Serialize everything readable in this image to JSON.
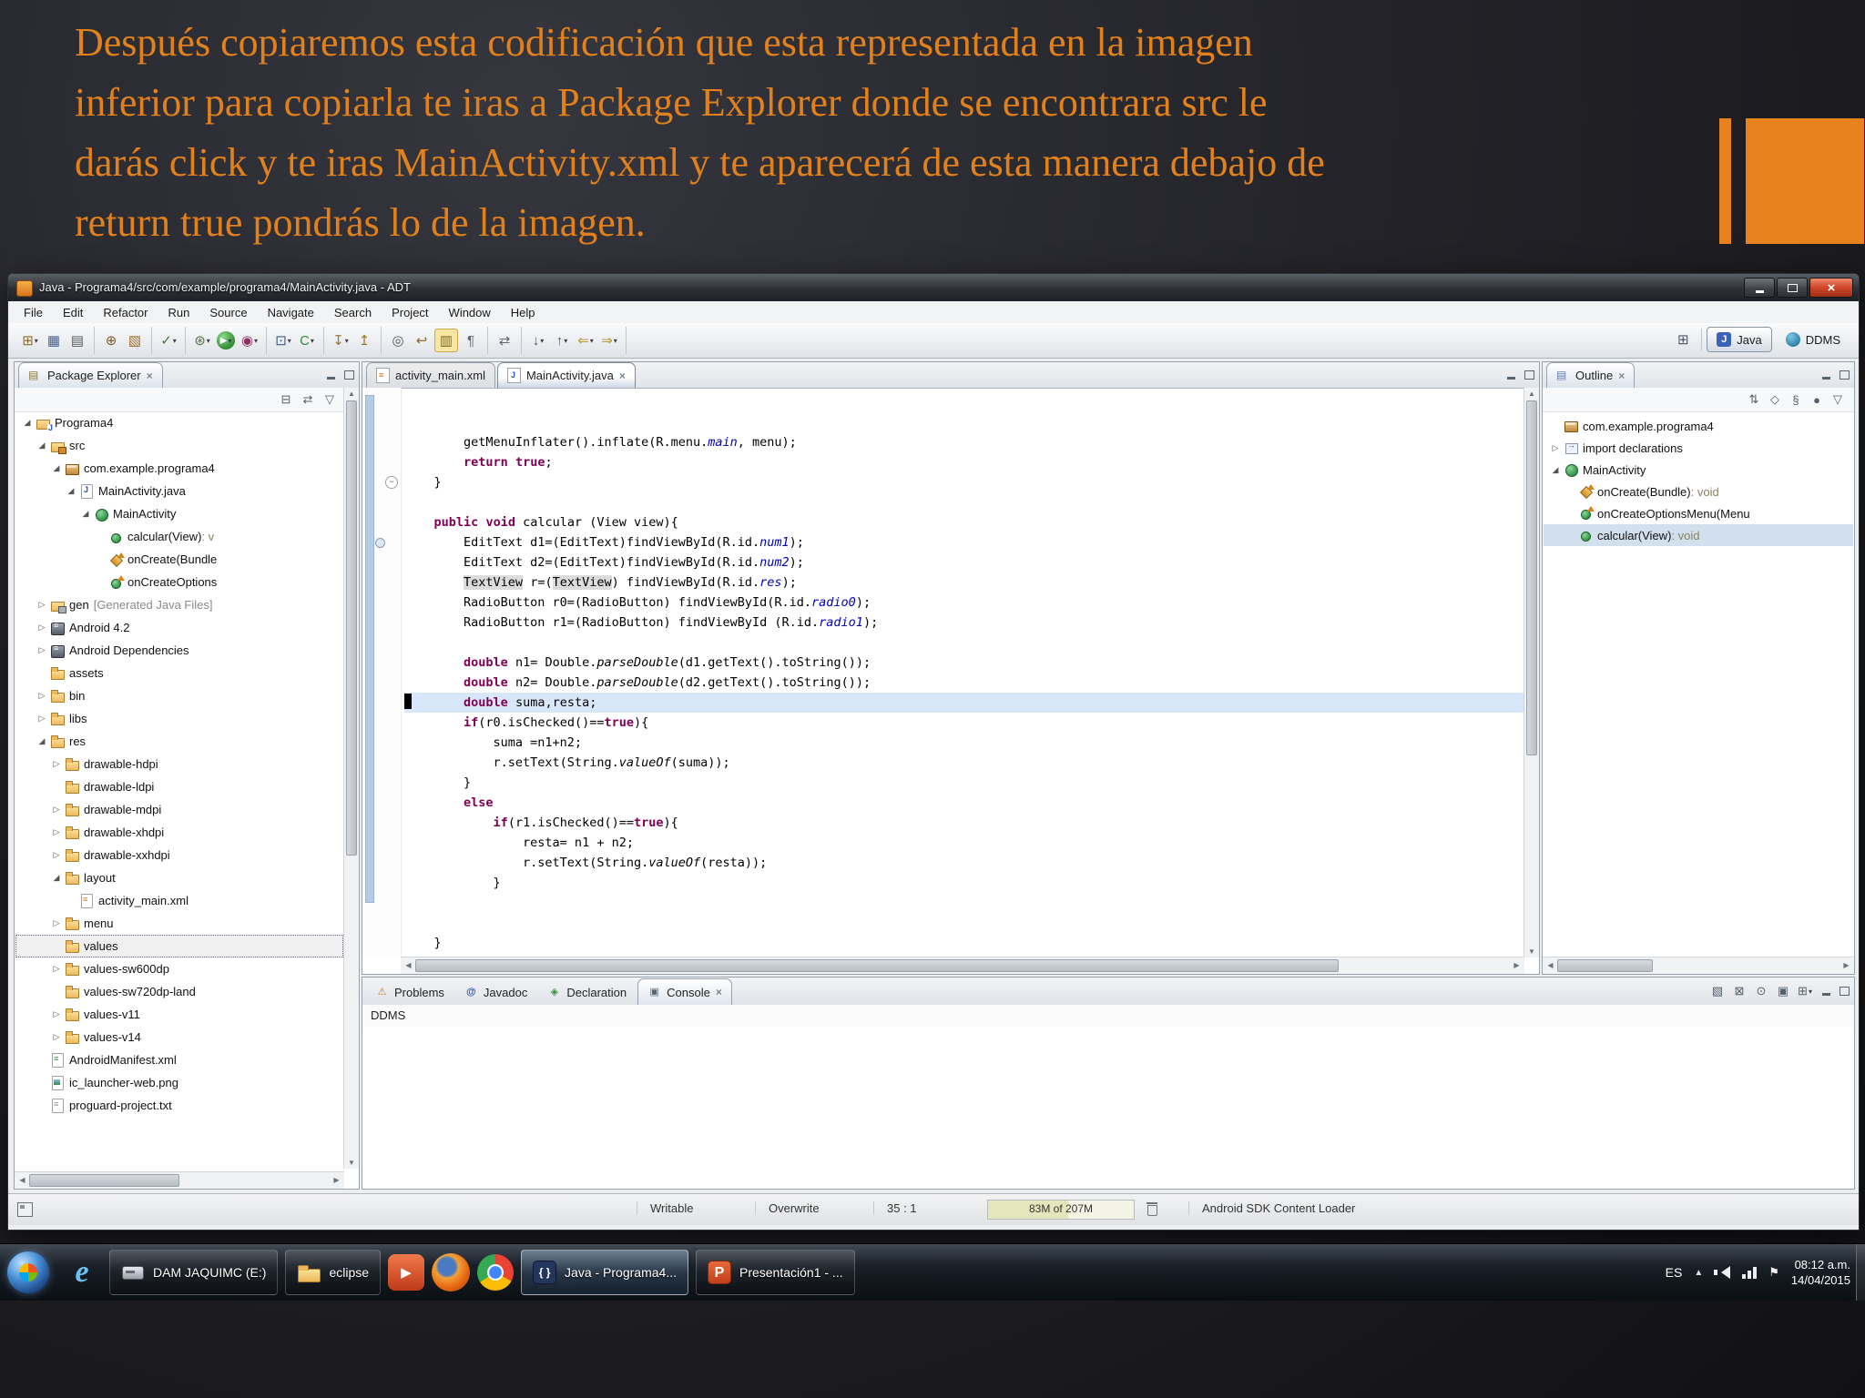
{
  "slide": {
    "caption_lines": [
      "Después copiaremos esta codificación que esta representada en la imagen",
      "inferior para copiarla te iras a Package Explorer donde se encontrara  src le",
      "darás click y te iras MainActivity.xml y te aparecerá de esta manera debajo de",
      "return true pondrás lo de la imagen."
    ],
    "accent_color": "#e8821e"
  },
  "window": {
    "title": "Java - Programa4/src/com/example/programa4/MainActivity.java - ADT",
    "menus": [
      "File",
      "Edit",
      "Refactor",
      "Run",
      "Source",
      "Navigate",
      "Search",
      "Project",
      "Window",
      "Help"
    ],
    "toolbar_groups": [
      [
        "new*",
        "save",
        "print"
      ],
      [
        "new-java-project",
        "new-package"
      ],
      [
        "task*"
      ],
      [
        "debug*",
        "run*",
        "profile*"
      ],
      [
        "new-project*",
        "new-class*"
      ],
      [
        "import*",
        "export"
      ],
      [
        "search",
        "last-edit",
        "mark-occurrences",
        "show-whitespace"
      ],
      [
        "link-editor"
      ],
      [
        "annotations-next*",
        "annotations-prev*",
        "back*",
        "forward*"
      ]
    ],
    "perspectives": [
      "Java",
      "DDMS"
    ]
  },
  "package_explorer": {
    "title": "Package Explorer",
    "toolbar": [
      "collapse-all",
      "link-with-editor",
      "view-menu"
    ],
    "tree": [
      {
        "d": 0,
        "a": "e",
        "ic": "project",
        "label": "Programa4"
      },
      {
        "d": 1,
        "a": "e",
        "ic": "src",
        "label": "src"
      },
      {
        "d": 2,
        "a": "e",
        "ic": "package",
        "label": "com.example.programa4"
      },
      {
        "d": 3,
        "a": "e",
        "ic": "jfile",
        "label": "MainActivity.java"
      },
      {
        "d": 4,
        "a": "e",
        "ic": "class",
        "label": "MainActivity"
      },
      {
        "d": 5,
        "a": null,
        "ic": "method",
        "label": "calcular(View)",
        "suffix": " : v"
      },
      {
        "d": 5,
        "a": null,
        "ic": "method-prot",
        "label": "onCreate(Bundle"
      },
      {
        "d": 5,
        "a": null,
        "ic": "method-o",
        "label": "onCreateOptions"
      },
      {
        "d": 1,
        "a": "c",
        "ic": "gen",
        "label": "gen",
        "deco": "[Generated Java Files]"
      },
      {
        "d": 1,
        "a": "c",
        "ic": "lib",
        "label": "Android 4.2"
      },
      {
        "d": 1,
        "a": "c",
        "ic": "lib",
        "label": "Android Dependencies"
      },
      {
        "d": 1,
        "a": null,
        "ic": "folder",
        "label": "assets"
      },
      {
        "d": 1,
        "a": "c",
        "ic": "folder",
        "label": "bin"
      },
      {
        "d": 1,
        "a": "c",
        "ic": "folder",
        "label": "libs"
      },
      {
        "d": 1,
        "a": "e",
        "ic": "folder",
        "label": "res"
      },
      {
        "d": 2,
        "a": "c",
        "ic": "folder",
        "label": "drawable-hdpi"
      },
      {
        "d": 2,
        "a": null,
        "ic": "folder",
        "label": "drawable-ldpi"
      },
      {
        "d": 2,
        "a": "c",
        "ic": "folder",
        "label": "drawable-mdpi"
      },
      {
        "d": 2,
        "a": "c",
        "ic": "folder",
        "label": "drawable-xhdpi"
      },
      {
        "d": 2,
        "a": "c",
        "ic": "folder",
        "label": "drawable-xxhdpi"
      },
      {
        "d": 2,
        "a": "e",
        "ic": "folder",
        "label": "layout"
      },
      {
        "d": 3,
        "a": null,
        "ic": "layoutxml",
        "label": "activity_main.xml"
      },
      {
        "d": 2,
        "a": "c",
        "ic": "folder",
        "label": "menu"
      },
      {
        "d": 2,
        "a": null,
        "ic": "folder",
        "label": "values",
        "sel": true
      },
      {
        "d": 2,
        "a": "c",
        "ic": "folder",
        "label": "values-sw600dp"
      },
      {
        "d": 2,
        "a": null,
        "ic": "folder",
        "label": "values-sw720dp-land"
      },
      {
        "d": 2,
        "a": "c",
        "ic": "folder",
        "label": "values-v11"
      },
      {
        "d": 2,
        "a": "c",
        "ic": "folder",
        "label": "values-v14"
      },
      {
        "d": 1,
        "a": null,
        "ic": "manifest",
        "label": "AndroidManifest.xml"
      },
      {
        "d": 1,
        "a": null,
        "ic": "image",
        "label": "ic_launcher-web.png"
      },
      {
        "d": 1,
        "a": null,
        "ic": "textfile",
        "label": "proguard-project.txt"
      }
    ]
  },
  "editor": {
    "tabs": [
      {
        "label": "activity_main.xml",
        "icon": "xml",
        "active": false
      },
      {
        "label": "MainActivity.java",
        "icon": "java",
        "active": true
      }
    ],
    "code": [
      {
        "seg": [
          [
            "",
            "        getMenuInflater().inflate(R.menu."
          ],
          [
            "sf",
            "main"
          ],
          [
            "",
            ", menu);"
          ]
        ]
      },
      {
        "seg": [
          [
            "",
            "        "
          ],
          [
            "k",
            "return"
          ],
          [
            "",
            " "
          ],
          [
            "k",
            "true"
          ],
          [
            "",
            ";"
          ]
        ]
      },
      {
        "seg": [
          [
            "",
            "    }"
          ]
        ]
      },
      {
        "seg": []
      },
      {
        "seg": [
          [
            "",
            "    "
          ],
          [
            "k",
            "public"
          ],
          [
            "",
            " "
          ],
          [
            "k",
            "void"
          ],
          [
            "",
            " calcular (View view){"
          ]
        ],
        "fold": true
      },
      {
        "seg": [
          [
            "",
            "        EditText d1=(EditText)findViewById(R.id."
          ],
          [
            "sf",
            "num1"
          ],
          [
            "",
            ");"
          ]
        ]
      },
      {
        "seg": [
          [
            "",
            "        EditText d2=(EditText)findViewById(R.id."
          ],
          [
            "sf",
            "num2"
          ],
          [
            "",
            ");"
          ]
        ]
      },
      {
        "seg": [
          [
            "",
            "        "
          ],
          [
            "oc",
            "TextView"
          ],
          [
            "",
            " r=("
          ],
          [
            "oc",
            "TextView"
          ],
          [
            "",
            ") findViewById(R.id."
          ],
          [
            "sf",
            "res"
          ],
          [
            "",
            ");"
          ]
        ],
        "mark": true
      },
      {
        "seg": [
          [
            "",
            "        RadioButton r0=(RadioButton) findViewById(R.id."
          ],
          [
            "sf",
            "radio0"
          ],
          [
            "",
            ");"
          ]
        ]
      },
      {
        "seg": [
          [
            "",
            "        RadioButton r1=(RadioButton) findViewById (R.id."
          ],
          [
            "sf",
            "radio1"
          ],
          [
            "",
            ");"
          ]
        ]
      },
      {
        "seg": []
      },
      {
        "seg": [
          [
            "",
            "        "
          ],
          [
            "k",
            "double"
          ],
          [
            "",
            " n1= Double."
          ],
          [
            "sm",
            "parseDouble"
          ],
          [
            "",
            "(d1.getText().toString());"
          ]
        ]
      },
      {
        "seg": [
          [
            "",
            "        "
          ],
          [
            "k",
            "double"
          ],
          [
            "",
            " n2= Double."
          ],
          [
            "sm",
            "parseDouble"
          ],
          [
            "",
            "(d2.getText().toString());"
          ]
        ]
      },
      {
        "seg": [
          [
            "",
            "        "
          ],
          [
            "k",
            "double"
          ],
          [
            "",
            " suma,resta;"
          ]
        ],
        "cur": true
      },
      {
        "seg": [
          [
            "",
            "        "
          ],
          [
            "k",
            "if"
          ],
          [
            "",
            "(r0.isChecked()=="
          ],
          [
            "k",
            "true"
          ],
          [
            "",
            "){"
          ]
        ]
      },
      {
        "seg": [
          [
            "",
            "            suma =n1+n2;"
          ]
        ]
      },
      {
        "seg": [
          [
            "",
            "            r.setText(String."
          ],
          [
            "sm",
            "valueOf"
          ],
          [
            "",
            "(suma));"
          ]
        ]
      },
      {
        "seg": [
          [
            "",
            "        }"
          ]
        ]
      },
      {
        "seg": [
          [
            "",
            "        "
          ],
          [
            "k",
            "else"
          ]
        ]
      },
      {
        "seg": [
          [
            "",
            "            "
          ],
          [
            "k",
            "if"
          ],
          [
            "",
            "(r1.isChecked()=="
          ],
          [
            "k",
            "true"
          ],
          [
            "",
            "){"
          ]
        ]
      },
      {
        "seg": [
          [
            "",
            "                resta= n1 + n2;"
          ]
        ]
      },
      {
        "seg": [
          [
            "",
            "                r.setText(String."
          ],
          [
            "sm",
            "valueOf"
          ],
          [
            "",
            "(resta));"
          ]
        ]
      },
      {
        "seg": [
          [
            "",
            "            }"
          ]
        ]
      },
      {
        "seg": []
      },
      {
        "seg": []
      },
      {
        "seg": [
          [
            "",
            "    }"
          ]
        ]
      },
      {
        "seg": []
      },
      {
        "seg": [
          [
            "",
            "}"
          ]
        ]
      }
    ]
  },
  "outline": {
    "title": "Outline",
    "toolbar": [
      "sort",
      "hide-fields",
      "hide-static",
      "hide-non-public",
      "view-menu"
    ],
    "items": [
      {
        "d": 0,
        "a": null,
        "ic": "package",
        "label": "com.example.programa4"
      },
      {
        "d": 0,
        "a": "c",
        "ic": "imports",
        "label": "import declarations"
      },
      {
        "d": 0,
        "a": "e",
        "ic": "class",
        "label": "MainActivity"
      },
      {
        "d": 1,
        "a": null,
        "ic": "method-prot",
        "label": "onCreate(Bundle)",
        "suffix": " : void"
      },
      {
        "d": 1,
        "a": null,
        "ic": "method-o",
        "label": "onCreateOptionsMenu(Menu"
      },
      {
        "d": 1,
        "a": null,
        "ic": "method",
        "label": "calcular(View)",
        "suffix": " : void",
        "sel": true
      }
    ]
  },
  "console": {
    "tabs": [
      {
        "label": "Problems",
        "icon": "problems",
        "active": false
      },
      {
        "label": "Javadoc",
        "icon": "javadoc",
        "active": false
      },
      {
        "label": "Declaration",
        "icon": "declaration",
        "active": false
      },
      {
        "label": "Console",
        "icon": "console",
        "active": true
      }
    ],
    "toolbar": [
      "clear-console",
      "scroll-lock",
      "pin-console",
      "display-selected-console",
      "open-console*"
    ],
    "title": "DDMS"
  },
  "status_bar": {
    "writable": "Writable",
    "input_mode": "Overwrite",
    "caret_position": "35 : 1",
    "heap": "83M of 207M",
    "message": "Android SDK Content Loader"
  },
  "taskbar": {
    "buttons": [
      {
        "kind": "orb",
        "name": "start-button"
      },
      {
        "kind": "app",
        "app": "ie",
        "name": "internet-explorer"
      },
      {
        "kind": "btn",
        "label": "DAM JAQUIMC (E:)",
        "icon": "drive",
        "name": "dam-jaquimc-drive"
      },
      {
        "kind": "btn",
        "label": "eclipse",
        "icon": "folder",
        "name": "eclipse-folder"
      },
      {
        "kind": "app",
        "app": "media",
        "name": "media-player"
      },
      {
        "kind": "app",
        "app": "firefox",
        "name": "firefox"
      },
      {
        "kind": "app",
        "app": "chrome",
        "name": "chrome"
      },
      {
        "kind": "btn",
        "label": "Java - Programa4...",
        "icon": "java-app",
        "active": true,
        "name": "java-programa4-window"
      },
      {
        "kind": "btn",
        "label": "Presentación1 - ...",
        "icon": "powerpoint",
        "name": "presentacion1-window"
      }
    ],
    "tray": {
      "language": "ES",
      "time": "08:12 a.m.",
      "date": "14/04/2015"
    }
  }
}
